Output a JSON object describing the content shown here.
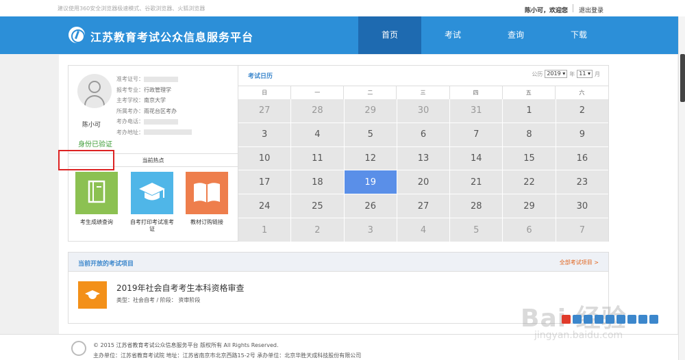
{
  "topbar": {
    "tip": "建议使用360安全浏览器极速模式、谷歌浏览器、火狐浏览器",
    "user_greeting": "陈小可，欢迎您",
    "logout": "退出登录"
  },
  "header": {
    "site_title": "江苏教育考试公众信息服务平台",
    "nav": [
      {
        "label": "首页",
        "active": true
      },
      {
        "label": "考试",
        "active": false
      },
      {
        "label": "查询",
        "active": false
      },
      {
        "label": "下载",
        "active": false
      }
    ]
  },
  "profile": {
    "name": "陈小可",
    "verified": "身份已验证",
    "fields": {
      "exam_no_label": "准考证号：",
      "major_label": "报考专业：",
      "major": "行政管理学",
      "school_label": "主考学校：",
      "school": "南京大学",
      "office_label": "所属考办：",
      "office": "雨花台区考办",
      "phone_label": "考办电话：",
      "address_label": "考办地址："
    },
    "hot_title": "当前热点",
    "hot_items": [
      {
        "label": "考生成绩查询",
        "icon": "notebook-icon",
        "color": "#8cc152"
      },
      {
        "label": "自考打印考试准考证",
        "icon": "graduation-cap-icon",
        "color": "#4fb6e8"
      },
      {
        "label": "教材订购链接",
        "icon": "open-book-icon",
        "color": "#ee7e4c"
      }
    ]
  },
  "calendar": {
    "title": "考试日历",
    "calendar_label": "公历",
    "year": "2019",
    "year_suffix": "年",
    "month": "11",
    "month_suffix": "月",
    "weekdays": [
      "日",
      "一",
      "二",
      "三",
      "四",
      "五",
      "六"
    ],
    "today": "19",
    "weeks": [
      [
        "27",
        "28",
        "29",
        "30",
        "31",
        "1",
        "2"
      ],
      [
        "3",
        "4",
        "5",
        "6",
        "7",
        "8",
        "9"
      ],
      [
        "10",
        "11",
        "12",
        "13",
        "14",
        "15",
        "16"
      ],
      [
        "17",
        "18",
        "19",
        "20",
        "21",
        "22",
        "23"
      ],
      [
        "24",
        "25",
        "26",
        "27",
        "28",
        "29",
        "30"
      ],
      [
        "1",
        "2",
        "3",
        "4",
        "5",
        "6",
        "7"
      ]
    ]
  },
  "open_exams": {
    "title": "当前开放的考试项目",
    "all_link": "全部考试项目 >",
    "items": [
      {
        "name": "2019年社会自考考生本科资格审查",
        "meta": "类型：社会自考 / 阶段： 资审阶段"
      }
    ]
  },
  "footer": {
    "copyright": "© 2015 江苏省教育考试公众信息服务平台 版权所有 All Rights Reserved.",
    "org": "主办单位：江苏省教育考试院 地址：江苏省南京市北京西路15-2号 承办单位：北京华胜天成科技股份有限公司"
  },
  "watermark": {
    "brand": "Bai 经验",
    "url": "jingyan.baidu.com"
  }
}
